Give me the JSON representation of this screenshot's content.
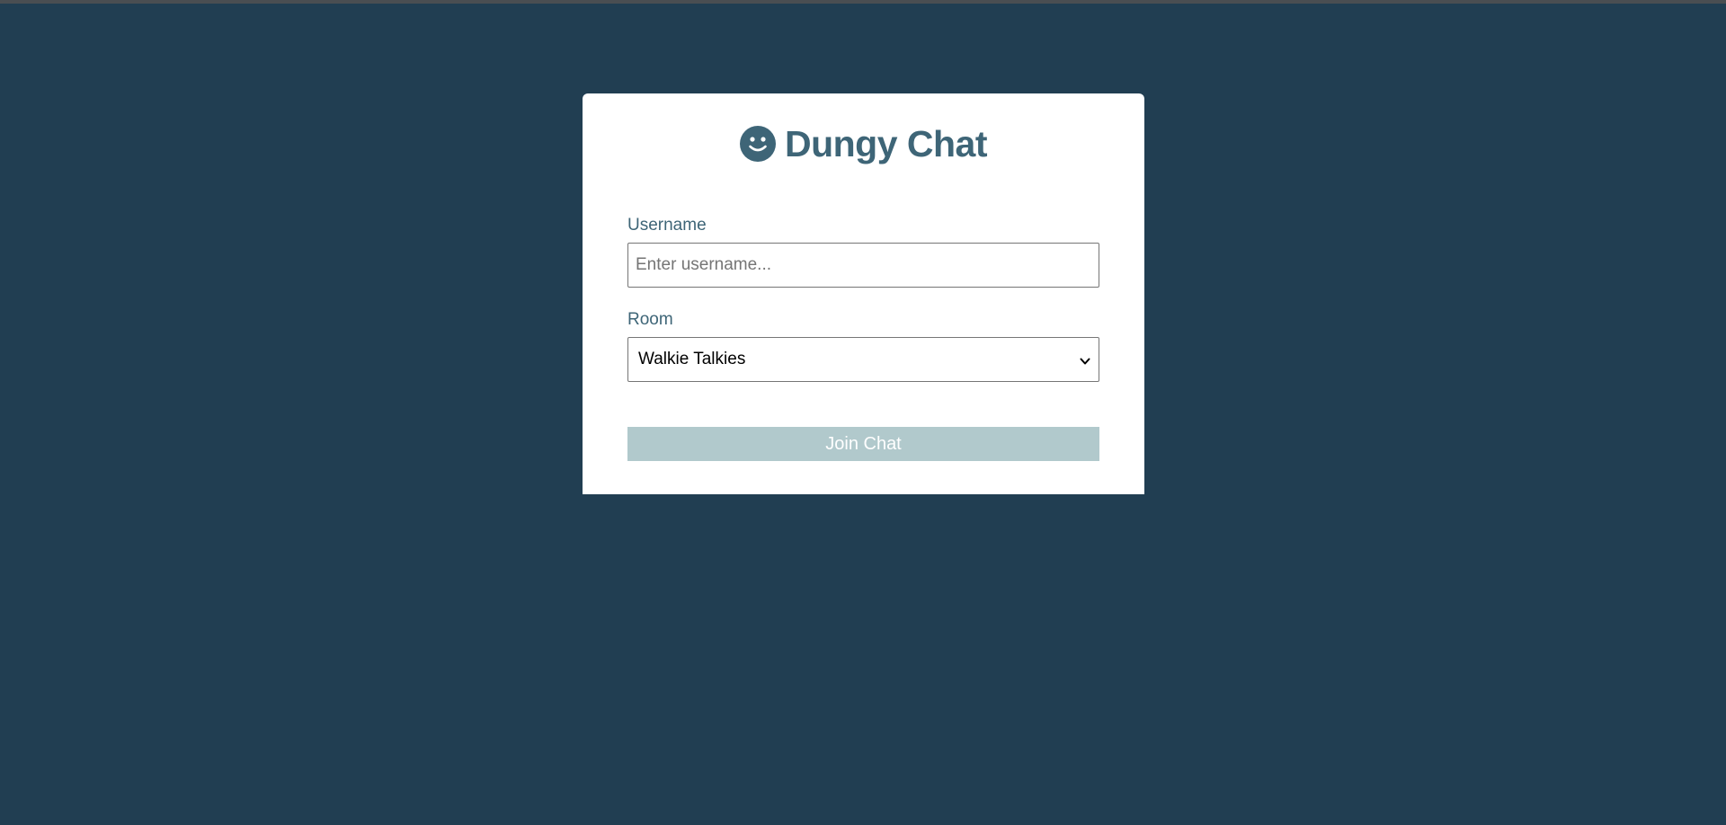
{
  "app": {
    "title": "Dungy Chat",
    "icon": "smiley-icon"
  },
  "form": {
    "username_label": "Username",
    "username_placeholder": "Enter username...",
    "username_value": "",
    "room_label": "Room",
    "room_selected": "Walkie Talkies",
    "room_icon": "chevron-down-icon",
    "join_label": "Join Chat",
    "join_disabled": true
  },
  "colors": {
    "background": "#213e52",
    "card": "#ffffff",
    "accent": "#3e6577",
    "button_disabled": "#b1c9cc",
    "button_text": "#ffffff"
  }
}
